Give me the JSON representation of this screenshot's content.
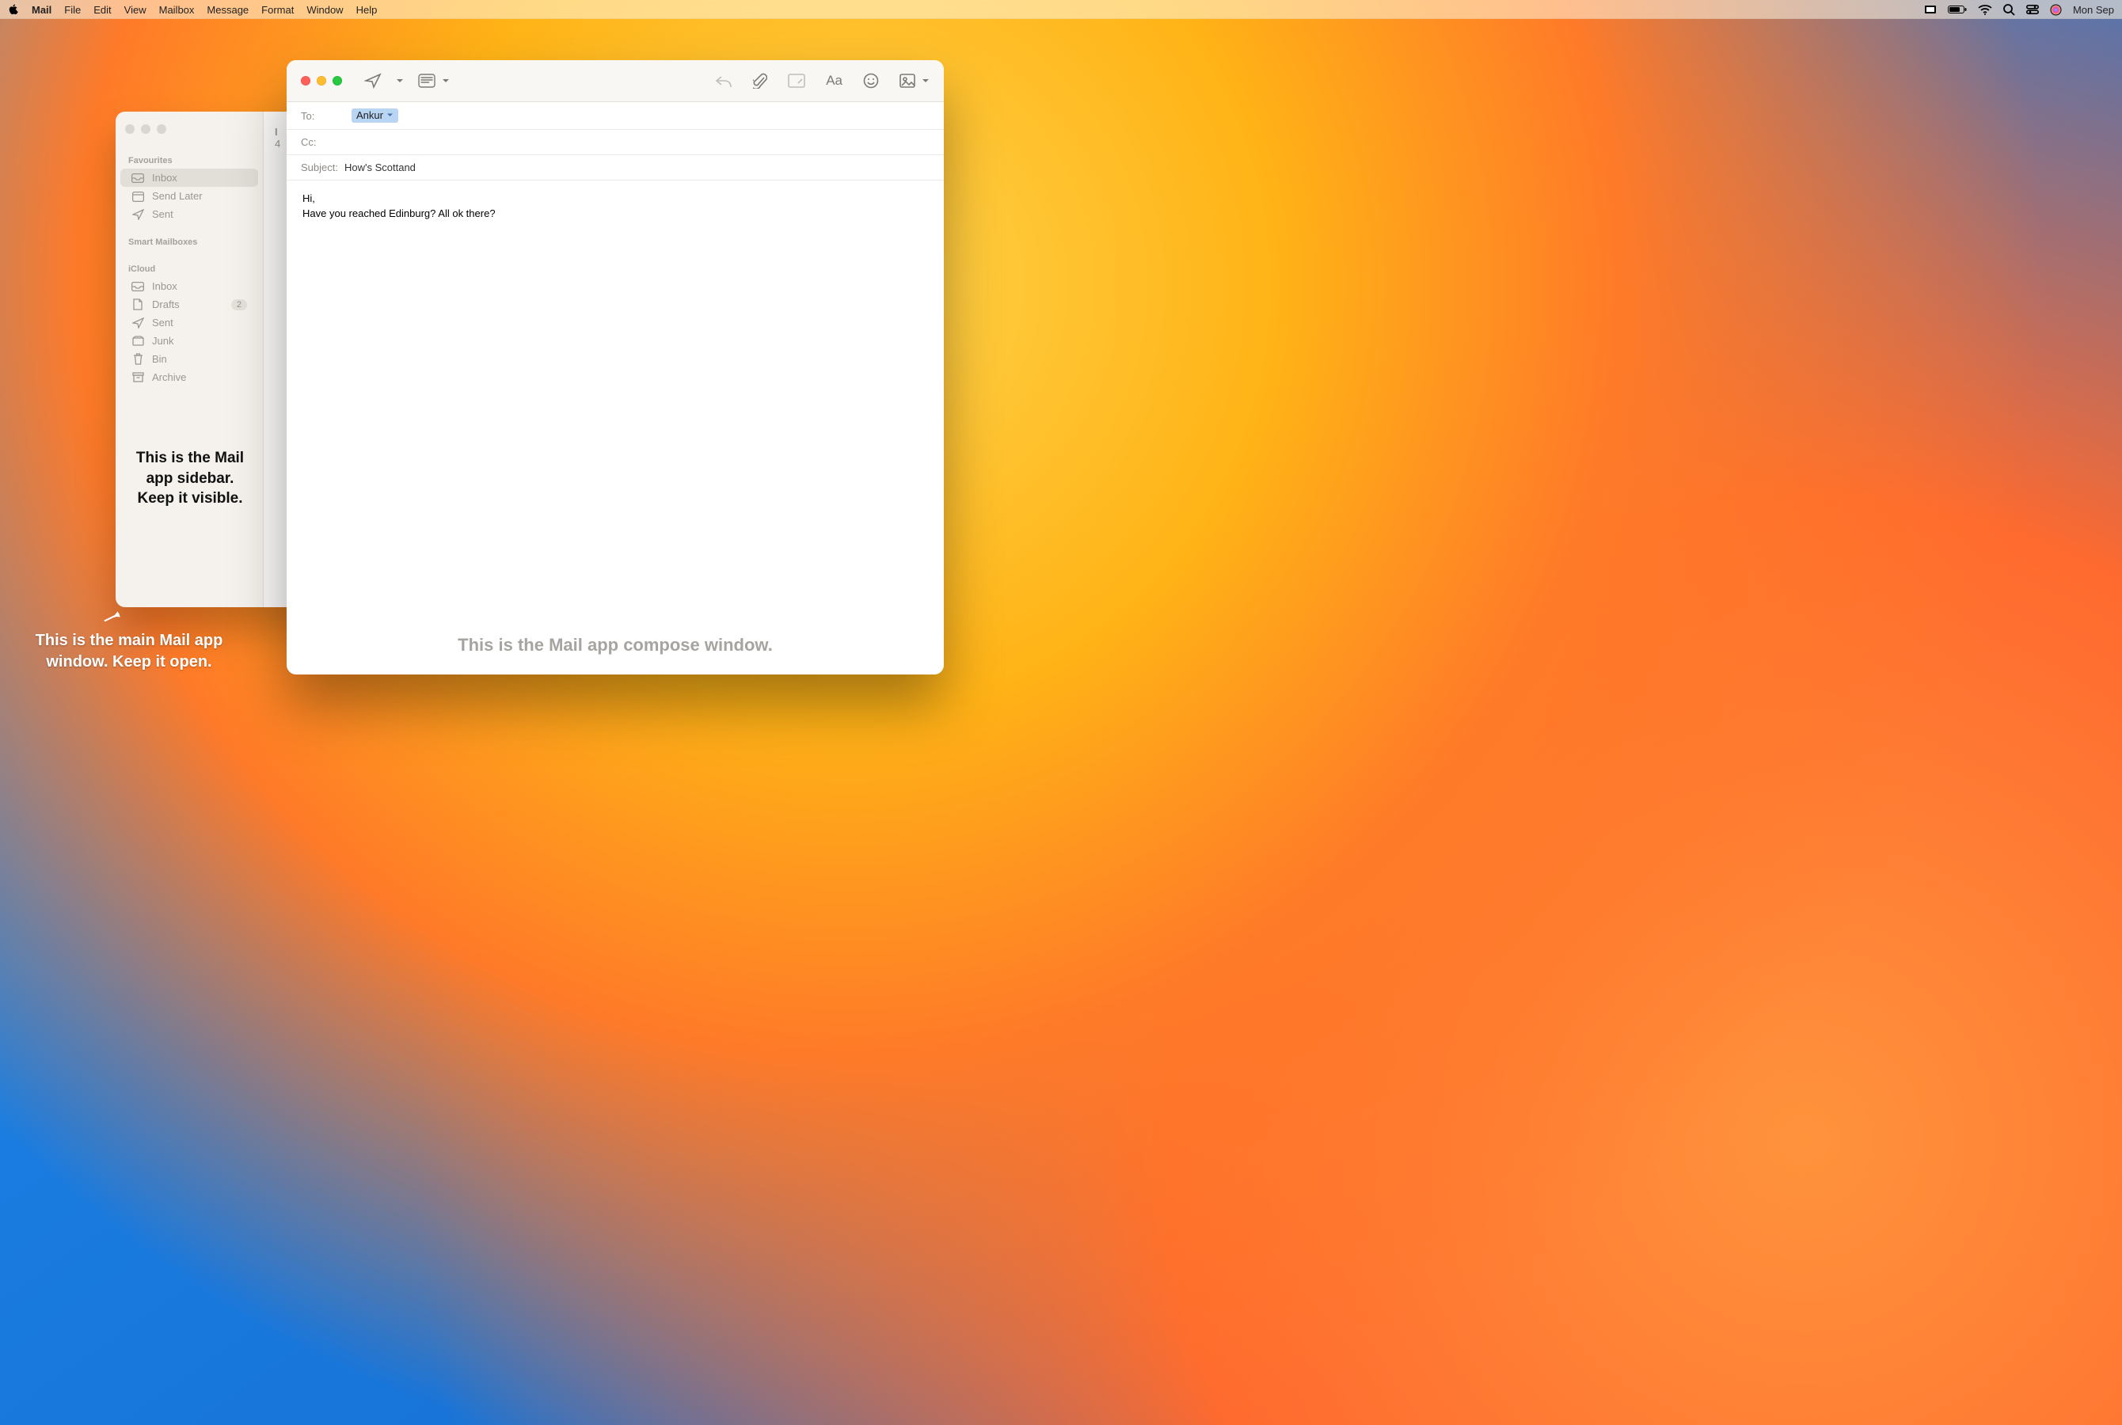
{
  "menubar": {
    "app": "Mail",
    "items": [
      "File",
      "Edit",
      "View",
      "Mailbox",
      "Message",
      "Format",
      "Window",
      "Help"
    ],
    "clock": "Mon Sep"
  },
  "sidebar": {
    "section1": "Favourites",
    "section2": "Smart Mailboxes",
    "section3": "iCloud",
    "fav_items": {
      "inbox": "Inbox",
      "sendlater": "Send Later",
      "sent": "Sent"
    },
    "icloud_items": {
      "inbox": "Inbox",
      "drafts": "Drafts",
      "drafts_count": "2",
      "sent": "Sent",
      "junk": "Junk",
      "bin": "Bin",
      "archive": "Archive"
    }
  },
  "listpane": {
    "line1": "I",
    "line2": "4"
  },
  "compose": {
    "to_label": "To:",
    "cc_label": "Cc:",
    "subject_label": "Subject:",
    "to_chip": "Ankur",
    "subject": "How's Scottand",
    "body": "Hi,\nHave you reached Edinburg? All ok there?"
  },
  "annotations": {
    "sidebar": "This is the Mail app sidebar. Keep it visible.",
    "main": "This is the main Mail app window. Keep it open.",
    "compose": "This is the Mail app\ncompose window."
  }
}
